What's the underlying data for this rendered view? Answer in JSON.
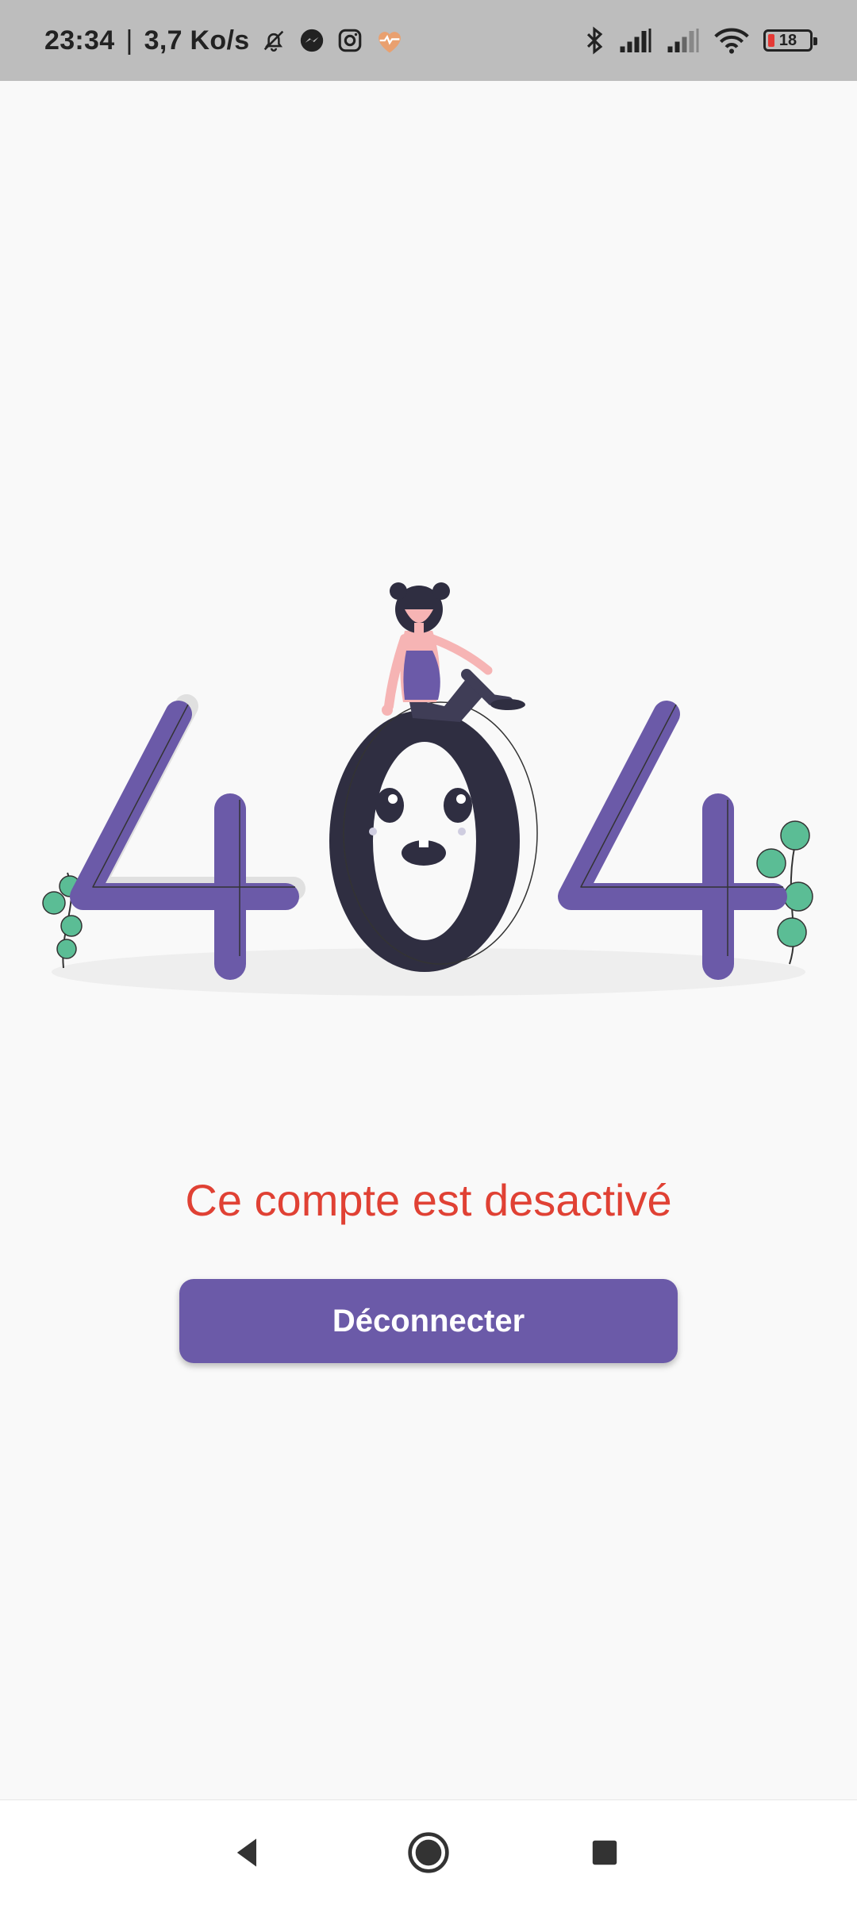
{
  "status_bar": {
    "time": "23:34",
    "separator": "|",
    "network_speed": "3,7 Ko/s",
    "left_icons": [
      "bell-off-icon",
      "messenger-icon",
      "instagram-icon",
      "heart-health-icon"
    ],
    "right_icons": [
      "bluetooth-icon",
      "signal-icon",
      "signal-icon",
      "wifi-icon",
      "battery-icon"
    ],
    "battery_level": "18"
  },
  "illustration": {
    "digits": [
      "4",
      "0",
      "4"
    ],
    "colors": {
      "accent": "#6b5aa8",
      "dark": "#2f2e41",
      "plant": "#5bbd95",
      "skin": "#f6b4b4"
    }
  },
  "main": {
    "message": "Ce compte est desactivé",
    "button_label": "Déconnecter",
    "message_color": "#e04134",
    "button_color": "#6b5aa8"
  },
  "nav_bar": {
    "buttons": [
      "back-icon",
      "home-icon",
      "recents-icon"
    ]
  }
}
